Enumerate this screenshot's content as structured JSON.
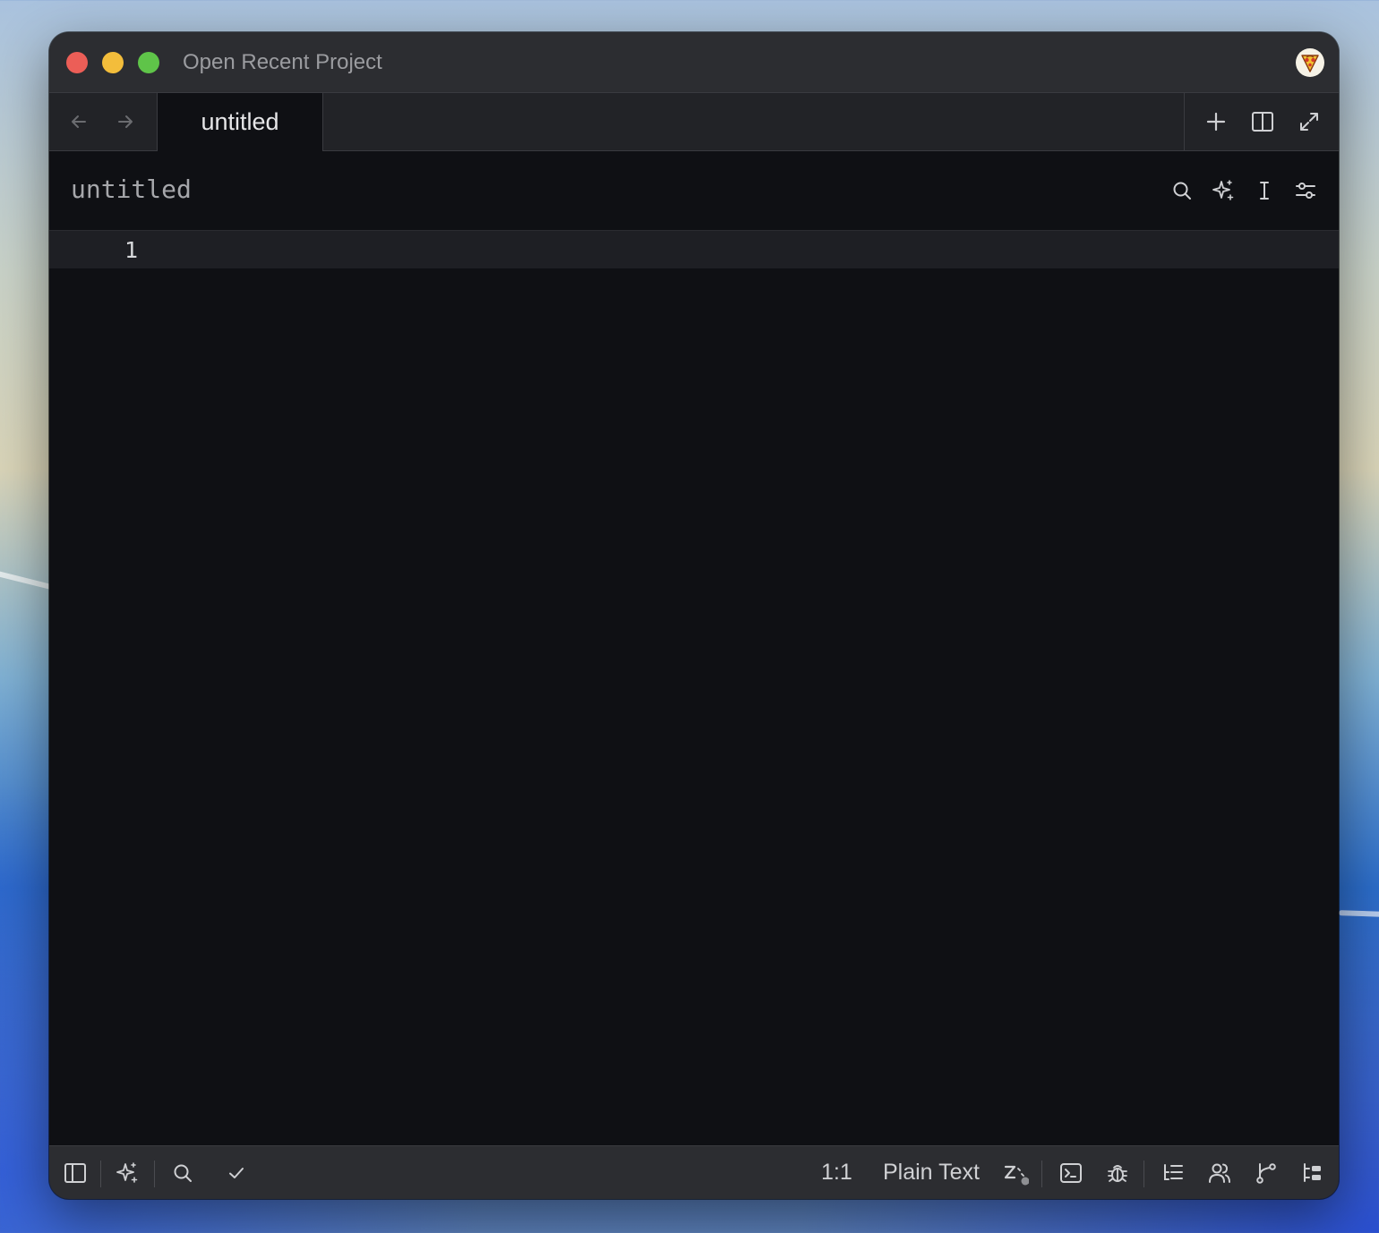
{
  "window": {
    "title": "Open Recent Project"
  },
  "tabs": [
    {
      "label": "untitled",
      "active": true
    }
  ],
  "breadcrumb": {
    "path": "untitled"
  },
  "editor": {
    "line_numbers": [
      "1"
    ]
  },
  "statusbar": {
    "cursor_position": "1:1",
    "language": "Plain Text"
  },
  "colors": {
    "editor_bg": "#0f1014",
    "chrome_bg": "#2c2d31",
    "tabbar_bg": "#222327",
    "traffic_red": "#ec5e57",
    "traffic_yellow": "#f3bd3b",
    "traffic_green": "#5fc449"
  },
  "icons": {
    "titlebar": [
      "avatar-icon"
    ],
    "tabbar": [
      "arrow-left-icon",
      "arrow-right-icon",
      "plus-icon",
      "split-pane-icon",
      "maximize-icon"
    ],
    "breadcrumb": [
      "search-icon",
      "sparkle-icon",
      "text-cursor-icon",
      "sliders-icon"
    ],
    "statusbar_left": [
      "sidebar-toggle-icon",
      "sparkle-icon",
      "search-icon",
      "check-icon"
    ],
    "statusbar_right": [
      "zed-predict-icon",
      "terminal-icon",
      "debug-bug-icon",
      "outline-icon",
      "collab-users-icon",
      "git-branch-icon",
      "project-panel-icon"
    ]
  }
}
